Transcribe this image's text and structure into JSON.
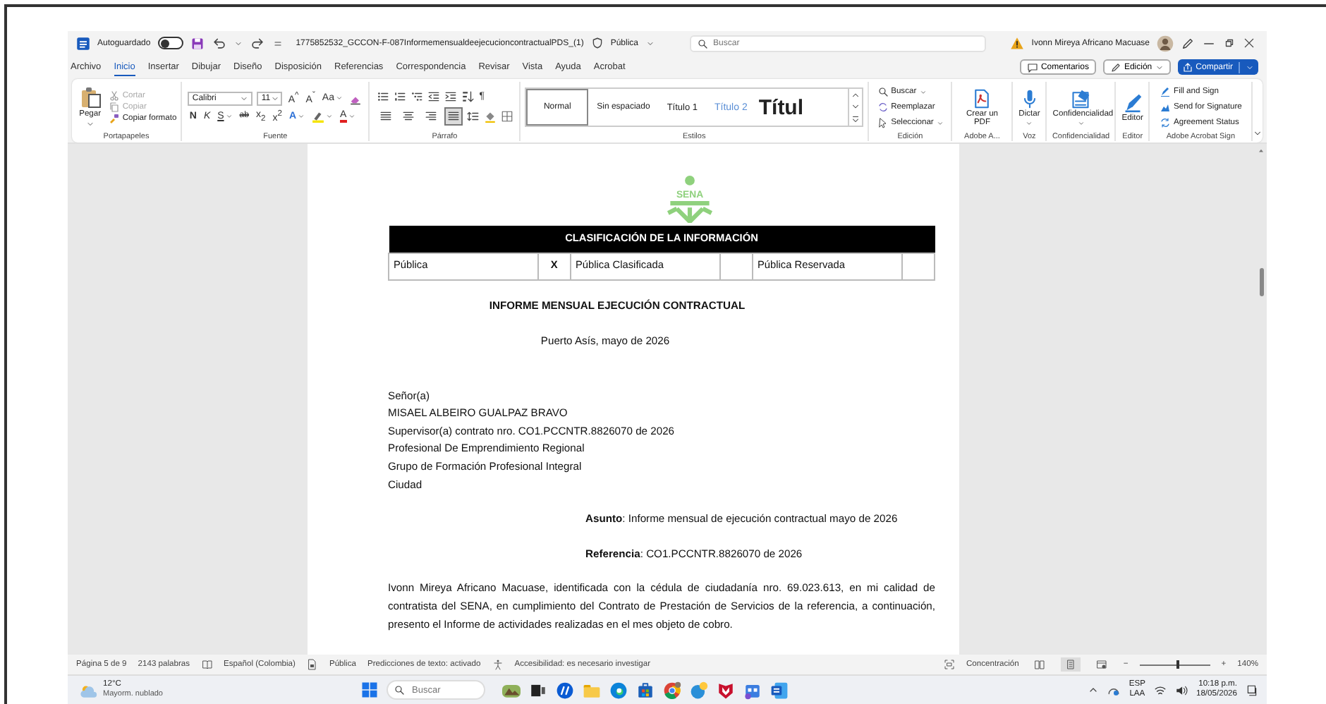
{
  "title_bar": {
    "autosave_label": "Autoguardado",
    "autosave_on": false,
    "filename": "1775852532_GCCON-F-087InformemensualdeejecucioncontractualPDS_(1)",
    "sensitivity": "Pública",
    "search_placeholder": "Buscar",
    "user_name": "Ivonn Mireya Africano Macuase"
  },
  "tabs": [
    {
      "label": "Archivo",
      "selected": false
    },
    {
      "label": "Inicio",
      "selected": true
    },
    {
      "label": "Insertar",
      "selected": false
    },
    {
      "label": "Dibujar",
      "selected": false
    },
    {
      "label": "Diseño",
      "selected": false
    },
    {
      "label": "Disposición",
      "selected": false
    },
    {
      "label": "Referencias",
      "selected": false
    },
    {
      "label": "Correspondencia",
      "selected": false
    },
    {
      "label": "Revisar",
      "selected": false
    },
    {
      "label": "Vista",
      "selected": false
    },
    {
      "label": "Ayuda",
      "selected": false
    },
    {
      "label": "Acrobat",
      "selected": false
    }
  ],
  "tab_actions": {
    "comments": "Comentarios",
    "editing": "Edición",
    "share": "Compartir"
  },
  "ribbon": {
    "clipboard": {
      "group": "Portapapeles",
      "paste": "Pegar",
      "items": [
        {
          "kind": "cut",
          "label": "Cortar",
          "disabled": true
        },
        {
          "kind": "copy",
          "label": "Copiar",
          "disabled": true
        },
        {
          "kind": "brush",
          "label": "Copiar formato",
          "disabled": false
        }
      ]
    },
    "font": {
      "group": "Fuente",
      "name": "Calibri",
      "size": "11",
      "row1": [
        {
          "label": "A$^{^}$",
          "dropdown": false
        },
        {
          "label": "A$^{ˇ}$",
          "dropdown": false
        },
        {
          "label": "Aa",
          "dropdown": true
        }
      ],
      "row2": [
        {
          "kind": "bold",
          "label": "N",
          "dropdown": false
        },
        {
          "kind": "italic",
          "label": "K",
          "dropdown": false
        },
        {
          "kind": "underline",
          "label": "S",
          "dropdown": true
        },
        {
          "kind": "strike",
          "label": "ab",
          "dropdown": false
        },
        {
          "kind": "sub",
          "label": "x$_{2}$",
          "dropdown": false
        },
        {
          "kind": "sup",
          "label": "x$^{2}$",
          "dropdown": false
        },
        {
          "kind": "effects",
          "label": "A",
          "dropdown": true
        },
        {
          "kind": "highlight",
          "dropdown": true
        },
        {
          "kind": "fontcolor",
          "label": "A",
          "dropdown": true
        }
      ]
    },
    "paragraph": {
      "group": "Párrafo",
      "pilcrow": "¶",
      "align": [
        {
          "kind": "left",
          "selected": false
        },
        {
          "kind": "center",
          "selected": false
        },
        {
          "kind": "right",
          "selected": false
        },
        {
          "kind": "justify",
          "selected": true
        }
      ]
    },
    "styles": {
      "group": "Estilos",
      "items": [
        {
          "label": "Normal",
          "kind": "normal",
          "selected": true
        },
        {
          "label": "Sin espaciado",
          "kind": "normal",
          "selected": false
        },
        {
          "label": "Título 1",
          "kind": "heading1",
          "selected": false
        },
        {
          "label": "Título 2",
          "kind": "heading2",
          "selected": false
        },
        {
          "label": "Títul",
          "kind": "title",
          "selected": false
        }
      ]
    },
    "editing": {
      "group": "Edición",
      "items": [
        {
          "kind": "find",
          "label": "Buscar",
          "dropdown": true
        },
        {
          "kind": "replace",
          "label": "Reemplazar",
          "dropdown": false
        },
        {
          "kind": "select",
          "label": "Seleccionar",
          "dropdown": true
        }
      ]
    },
    "big": [
      {
        "kind": "pdf",
        "label": "Crear un PDF",
        "group": "Adobe A...",
        "dropdown": false
      },
      {
        "kind": "mic",
        "label": "Dictar",
        "group": "Voz",
        "dropdown": true
      },
      {
        "kind": "confidential",
        "label": "Confidencialidad",
        "group": "Confidencialidad",
        "dropdown": true
      },
      {
        "kind": "editor",
        "label": "Editor",
        "group": "Editor",
        "dropdown": false
      }
    ],
    "sign": {
      "group": "Adobe Acrobat Sign",
      "items": [
        {
          "kind": "fill",
          "label": "Fill and Sign"
        },
        {
          "kind": "send",
          "label": "Send for Signature"
        },
        {
          "kind": "status",
          "label": "Agreement Status"
        }
      ]
    }
  },
  "document": {
    "logo_text": "SENA",
    "classification": {
      "header": "CLASIFICACIÓN DE LA INFORMACIÓN",
      "cells": [
        {
          "label": "Pública",
          "mark": "X"
        },
        {
          "label": "Pública Clasificada"
        },
        {
          "label": "Pública Reservada"
        }
      ]
    },
    "title": "INFORME MENSUAL EJECUCIÓN CONTRACTUAL",
    "place_date": "Puerto Asís, mayo de 2026",
    "recipient": [
      "Señor(a)",
      "MISAEL ALBEIRO GUALPAZ BRAVO",
      "Supervisor(a) contrato nro. CO1.PCCNTR.8826070 de 2026",
      "Profesional De Emprendimiento Regional",
      "Grupo de Formación Profesional Integral",
      "Ciudad"
    ],
    "subject": "**Asunto**: Informe mensual de ejecución contractual mayo de 2026",
    "reference": "**Referencia**: CO1.PCCNTR.8826070 de 2026",
    "body": "Ivonn Mireya Africano Macuase, identificada con la cédula de ciudadanía nro. 69.023.613, en mi calidad de contratista del SENA, en cumplimiento del Contrato de Prestación de Servicios de la referencia, a continuación, presento el Informe de actividades realizadas en el mes objeto de cobro."
  },
  "status_bar": {
    "page": "Página 5 de 9",
    "words": "2143 palabras",
    "language": "Español (Colombia)",
    "sensitivity": "Pública",
    "predictions": "Predicciones de texto: activado",
    "accessibility": "Accesibilidad: es necesario investigar",
    "focus": "Concentración",
    "views": [
      {
        "kind": "read",
        "selected": false
      },
      {
        "kind": "print",
        "selected": true
      },
      {
        "kind": "web",
        "selected": false
      }
    ],
    "zoom_minus": "−",
    "zoom_plus": "+",
    "zoom": {
      "level": 0.55
    },
    "zoom_value": "140%"
  },
  "taskbar": {
    "temperature": "12°C",
    "weather": "Mayorm. nublado",
    "search_placeholder": "Buscar",
    "lang": "ESP",
    "layout": "LAA",
    "time": "10:18 p.m.",
    "date": "18/05/2026"
  }
}
